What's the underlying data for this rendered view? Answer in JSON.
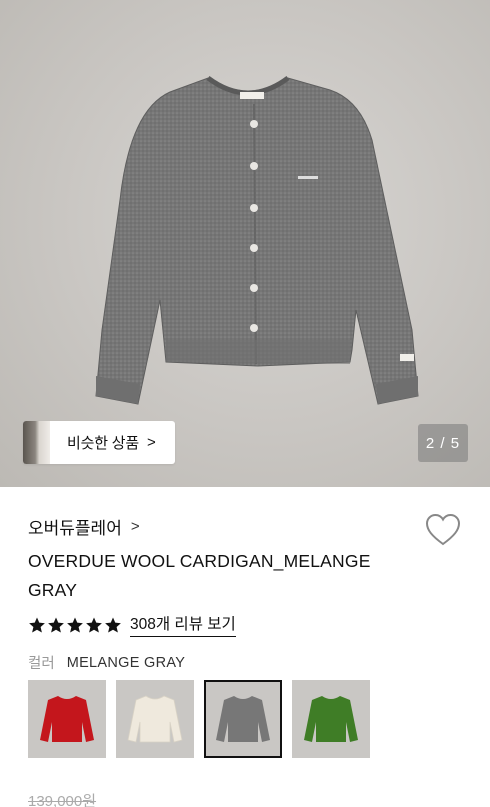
{
  "hero": {
    "similar_button_label": "비슷한 상품",
    "similar_chevron": ">",
    "pager_text": "2 / 5",
    "garment_color": "#7a7a7a"
  },
  "brand": {
    "name": "오버듀플레어",
    "chevron": ">"
  },
  "product": {
    "title": "OVERDUE WOOL CARDIGAN_MELANGE GRAY",
    "rating_stars": 5,
    "review_link": "308개 리뷰 보기"
  },
  "color": {
    "label": "컬러",
    "selected_value": "MELANGE GRAY",
    "options": [
      {
        "name": "red",
        "hex": "#c4161c",
        "selected": false
      },
      {
        "name": "cream",
        "hex": "#efe9dd",
        "selected": false
      },
      {
        "name": "melange-gray",
        "hex": "#777777",
        "selected": true
      },
      {
        "name": "green",
        "hex": "#3f7d26",
        "selected": false
      }
    ]
  },
  "price": {
    "original": "139,000원"
  },
  "icons": {
    "heart": "heart-outline-icon",
    "star": "star-icon",
    "chevron": "chevron-right-icon"
  }
}
